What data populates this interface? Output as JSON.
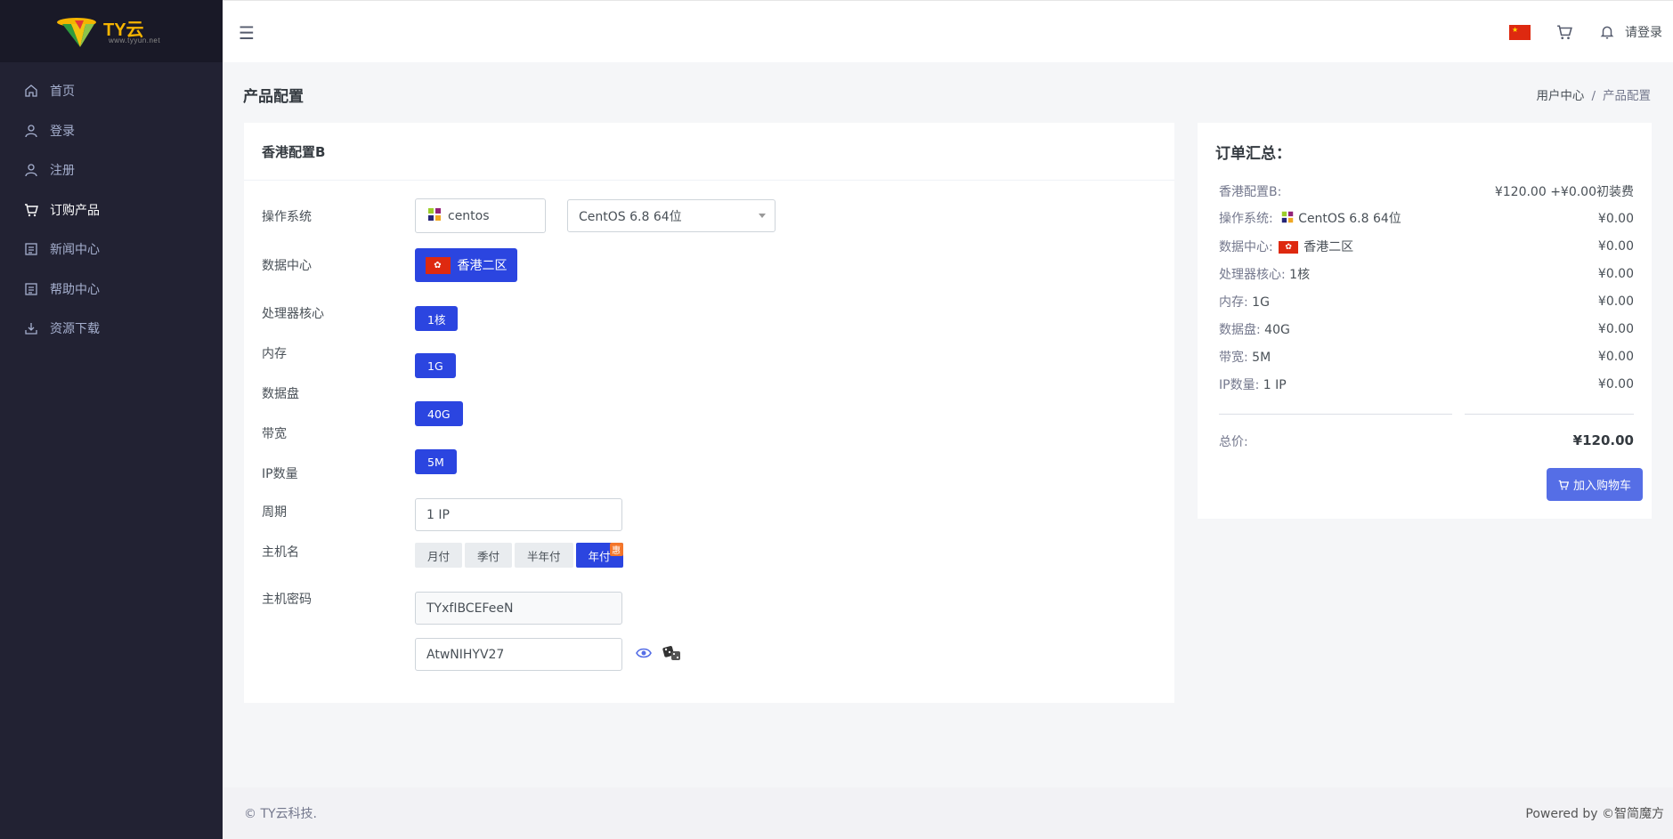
{
  "brand": {
    "logo_text": "TY云",
    "logo_sub": "www.tyyun.net"
  },
  "sidebar": {
    "items": [
      {
        "label": "首页",
        "icon": "home-icon",
        "active": false
      },
      {
        "label": "登录",
        "icon": "user-icon",
        "active": false
      },
      {
        "label": "注册",
        "icon": "user-add-icon",
        "active": false
      },
      {
        "label": "订购产品",
        "icon": "cart-icon",
        "active": true
      },
      {
        "label": "新闻中心",
        "icon": "news-icon",
        "active": false
      },
      {
        "label": "帮助中心",
        "icon": "help-icon",
        "active": false
      },
      {
        "label": "资源下载",
        "icon": "download-icon",
        "active": false
      }
    ]
  },
  "topbar": {
    "login_label": "请登录"
  },
  "page": {
    "title": "产品配置",
    "breadcrumb": [
      "用户中心",
      "产品配置"
    ]
  },
  "config": {
    "product_name": "香港配置B",
    "labels": {
      "os": "操作系统",
      "datacenter": "数据中心",
      "cpu": "处理器核心",
      "memory": "内存",
      "disk": "数据盘",
      "bandwidth": "带宽",
      "ip": "IP数量",
      "period": "周期",
      "hostname": "主机名",
      "password": "主机密码"
    },
    "os_value": "centos",
    "os_version": "CentOS 6.8 64位",
    "datacenter_value": "香港二区",
    "cpu_value": "1核",
    "memory_value": "1G",
    "disk_value": "40G",
    "bandwidth_value": "5M",
    "ip_value": "1 IP",
    "periods": [
      "月付",
      "季付",
      "半年付",
      "年付"
    ],
    "period_selected": "年付",
    "period_badge": "惠",
    "hostname_value": "TYxfIBCEFeeN",
    "password_value": "AtwNIHYV27"
  },
  "summary": {
    "title": "订单汇总：",
    "rows": [
      {
        "key": "香港配置B:",
        "detail": "",
        "value": "¥120.00 +¥0.00初装费"
      },
      {
        "key": "操作系统:",
        "detail": "CentOS 6.8 64位",
        "value": "¥0.00"
      },
      {
        "key": "数据中心:",
        "detail": "香港二区",
        "value": "¥0.00"
      },
      {
        "key": "处理器核心:",
        "detail": "1核",
        "value": "¥0.00"
      },
      {
        "key": "内存:",
        "detail": "1G",
        "value": "¥0.00"
      },
      {
        "key": "数据盘:",
        "detail": "40G",
        "value": "¥0.00"
      },
      {
        "key": "带宽:",
        "detail": "5M",
        "value": "¥0.00"
      },
      {
        "key": "IP数量:",
        "detail": "1 IP",
        "value": "¥0.00"
      }
    ],
    "total_label": "总价:",
    "total_value": "¥120.00",
    "cart_button": "加入购物车"
  },
  "footer": {
    "left": "© TY云科技.",
    "right": "Powered by ©智简魔方"
  },
  "colors": {
    "sidebar_bg": "#222233",
    "primary": "#2b45e0",
    "cart_button": "#556ee6",
    "badge": "#f4762a"
  }
}
